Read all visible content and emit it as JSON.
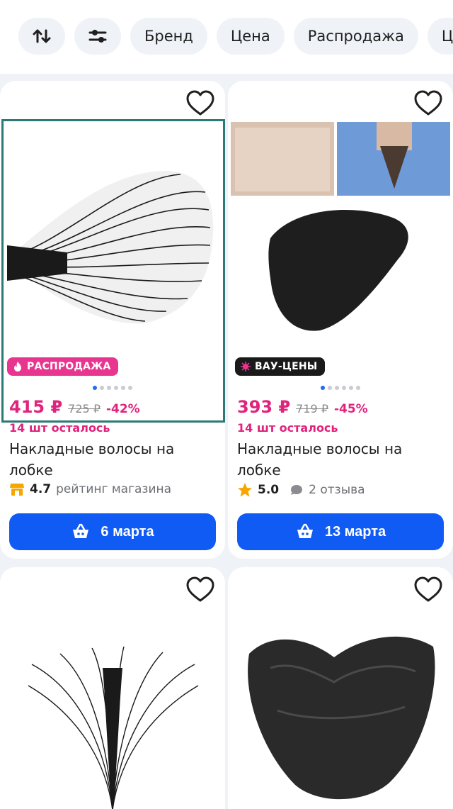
{
  "filters": {
    "sort_icon": "sort-arrows-icon",
    "settings_icon": "sliders-icon",
    "chips": [
      "Бренд",
      "Цена",
      "Распродажа",
      "Ц"
    ]
  },
  "products": [
    {
      "badge": "РАСПРОДАЖА",
      "badge_icon": "flame-icon",
      "price": "415 ₽",
      "old_price": "725 ₽",
      "discount": "-42%",
      "stock": "14 шт осталось",
      "title": "Накладные волосы на лобке",
      "rating": "4.7",
      "rating_label": "рейтинг магазина",
      "delivery": "6 марта"
    },
    {
      "badge": "ВАУ-ЦЕНЫ",
      "badge_icon": "spark-icon",
      "price": "393 ₽",
      "old_price": "719 ₽",
      "discount": "-45%",
      "stock": "14 шт осталось",
      "title": "Накладные волосы на лобке",
      "rating": "5.0",
      "reviews": "2 отзыва",
      "delivery": "13 марта"
    }
  ],
  "colors": {
    "accent_blue": "#0f5bf4",
    "sale_pink": "#e8358f",
    "price_pink": "#e0237c"
  }
}
